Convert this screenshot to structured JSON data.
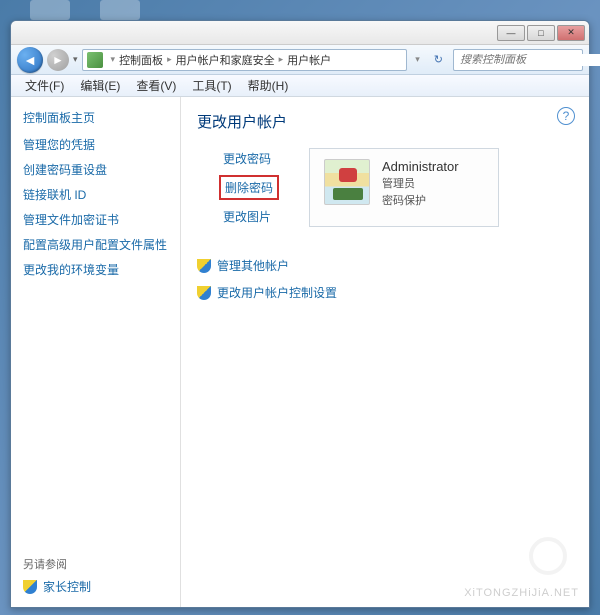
{
  "titlebar": {
    "min": "—",
    "max": "□",
    "close": "✕"
  },
  "nav": {
    "back": "◄",
    "forward": "►",
    "dropdown": "▾",
    "refresh": "↻"
  },
  "breadcrumb": {
    "root_sep": "«",
    "items": [
      "控制面板",
      "用户帐户和家庭安全",
      "用户帐户"
    ],
    "sep": "▸"
  },
  "search": {
    "placeholder": "搜索控制面板"
  },
  "menu": {
    "items": [
      "文件(F)",
      "编辑(E)",
      "查看(V)",
      "工具(T)",
      "帮助(H)"
    ]
  },
  "sidebar": {
    "home": "控制面板主页",
    "links": [
      "管理您的凭据",
      "创建密码重设盘",
      "链接联机 ID",
      "管理文件加密证书",
      "配置高级用户配置文件属性",
      "更改我的环境变量"
    ],
    "see_also": "另请参阅",
    "footer_link": "家长控制"
  },
  "main": {
    "help": "?",
    "title": "更改用户帐户",
    "actions": [
      {
        "label": "更改密码",
        "highlighted": false
      },
      {
        "label": "删除密码",
        "highlighted": true
      },
      {
        "label": "更改图片",
        "highlighted": false
      }
    ],
    "account": {
      "name": "Administrator",
      "role": "管理员",
      "pwd_status": "密码保护"
    },
    "secondary": [
      "管理其他帐户",
      "更改用户帐户控制设置"
    ]
  },
  "watermark": "XiTONGZHiJiA.NET"
}
